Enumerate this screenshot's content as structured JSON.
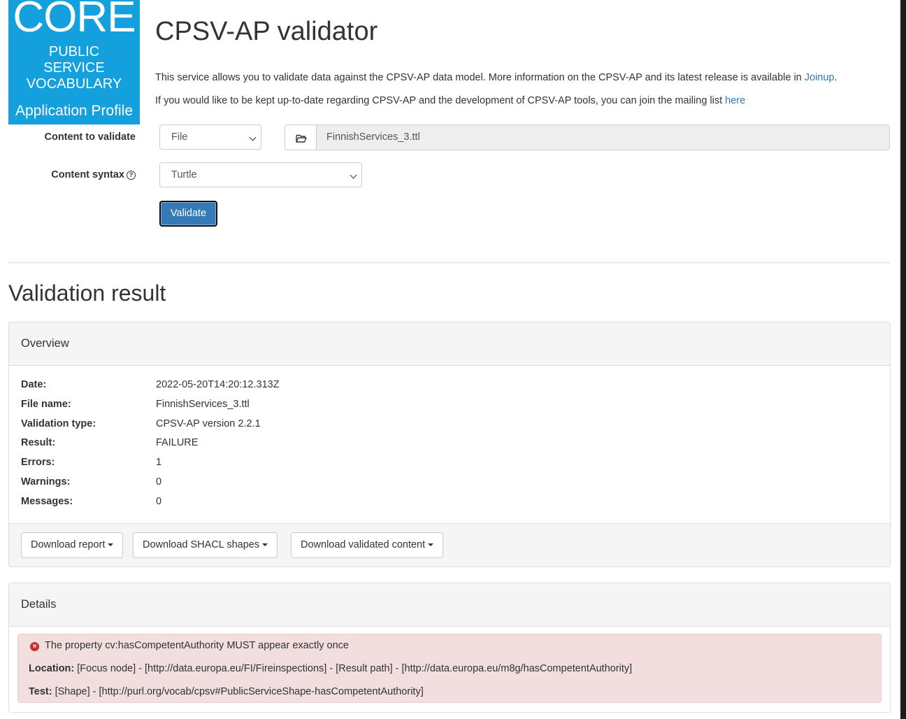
{
  "logo": {
    "line1": "CORE",
    "line2": "PUBLIC",
    "line3": "SERVICE",
    "line4": "VOCABULARY",
    "line5": "Application Profile"
  },
  "header": {
    "title": "CPSV-AP validator",
    "intro1_text": "This service allows you to validate data against the CPSV-AP data model. More information on the CPSV-AP and its latest release is available in ",
    "intro1_link": "Joinup",
    "intro1_end": ".",
    "intro2_text": "If you would like to be kept up-to-date regarding CPSV-AP and the development of CPSV-AP tools, you can join the mailing list ",
    "intro2_link": "here"
  },
  "form": {
    "content_label": "Content to validate",
    "content_type_selected": "File",
    "file_name": "FinnishServices_3.ttl",
    "syntax_label": "Content syntax",
    "syntax_selected": "Turtle",
    "validate_label": "Validate"
  },
  "result": {
    "title": "Validation result",
    "overview_heading": "Overview",
    "rows": [
      {
        "key": "Date:",
        "value": "2022-05-20T14:20:12.313Z"
      },
      {
        "key": "File name:",
        "value": "FinnishServices_3.ttl"
      },
      {
        "key": "Validation type:",
        "value": "CPSV-AP version 2.2.1"
      },
      {
        "key": "Result:",
        "value": "FAILURE"
      },
      {
        "key": "Errors:",
        "value": "1"
      },
      {
        "key": "Warnings:",
        "value": "0"
      },
      {
        "key": "Messages:",
        "value": "0"
      }
    ],
    "download_report": "Download report",
    "download_shapes": "Download SHACL shapes",
    "download_content": "Download validated content"
  },
  "details": {
    "heading": "Details",
    "message": "The property cv:hasCompetentAuthority MUST appear exactly once",
    "location_label": "Location:",
    "location_value": "[Focus node] - [http://data.europa.eu/FI/Fireinspections] - [Result path] - [http://data.europa.eu/m8g/hasCompetentAuthority]",
    "test_label": "Test:",
    "test_value": "[Shape] - [http://purl.org/vocab/cpsv#PublicServiceShape-hasCompetentAuthority]"
  },
  "colors": {
    "logo_bg": "#13a0dc",
    "primary": "#337ab7",
    "alert_bg": "#f2dede",
    "error_icon": "#c9302c"
  },
  "icons": [
    "folder-open-icon",
    "question-circle-icon",
    "chevron-down-icon",
    "caret-down-icon",
    "error-circle-icon"
  ]
}
